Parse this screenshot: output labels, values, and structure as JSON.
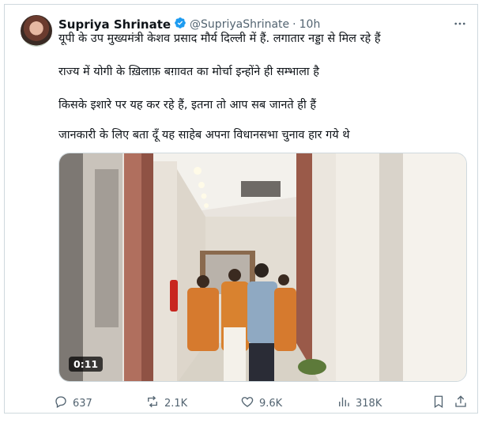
{
  "author": {
    "name": "Supriya Shrinate",
    "handle": "@SupriyaShrinate",
    "separator": "·",
    "time": "10h"
  },
  "tweet_lines": [
    "यूपी के उप मुख्यमंत्री केशव प्रसाद मौर्य दिल्ली में हैं. लगातार नड्डा से मिल रहे हैं",
    "राज्य में योगी के ख़िलाफ़ बग़ावत का मोर्चा इन्होंने ही सम्भाला है",
    "किसके इशारे पर यह कर रहे हैं, इतना तो आप सब जानते ही हैं",
    "जानकारी के लिए बता दूँ यह साहेब अपना विधानसभा चुनाव हार गये थे"
  ],
  "media": {
    "duration": "0:11"
  },
  "stats": {
    "replies": "637",
    "reposts": "2.1K",
    "likes": "9.6K",
    "views": "318K"
  },
  "colors": {
    "muted": "#536471",
    "text": "#0f1419",
    "verified": "#1d9bf0",
    "border": "#cfd9de"
  }
}
